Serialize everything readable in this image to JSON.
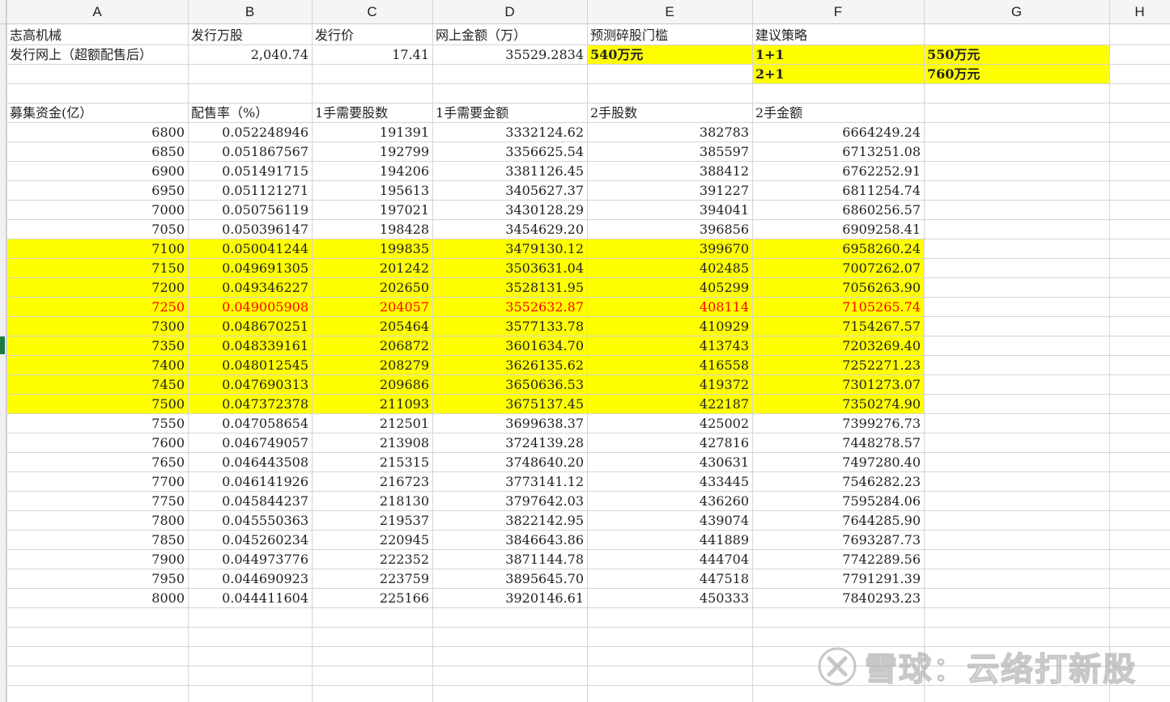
{
  "columns": [
    "A",
    "B",
    "C",
    "D",
    "E",
    "F",
    "G",
    "H"
  ],
  "row2": {
    "name": "志高机械",
    "issue_shares_label": "发行万股",
    "price_label": "发行价",
    "online_amount_label": "网上金额（万）",
    "threshold_label": "预测碎股门槛",
    "strategy_label": "建议策略"
  },
  "row3": {
    "label": "发行网上（超额配售后）",
    "issue_shares": "2,040.74",
    "price": "17.41",
    "online_amount": "35529.2834",
    "threshold": "540万元",
    "strategy_1": "1+1",
    "strategy_1_amount": "550万元"
  },
  "row4": {
    "strategy_2": "2+1",
    "strategy_2_amount": "760万元"
  },
  "table_headers": [
    "募集资金(亿）",
    "配售率（%）",
    "1手需要股数",
    "1手需要金额",
    "2手股数",
    "2手金额"
  ],
  "rows": [
    [
      "6800",
      "0.052248946",
      "191391",
      "3332124.62",
      "382783",
      "6664249.24"
    ],
    [
      "6850",
      "0.051867567",
      "192799",
      "3356625.54",
      "385597",
      "6713251.08"
    ],
    [
      "6900",
      "0.051491715",
      "194206",
      "3381126.45",
      "388412",
      "6762252.91"
    ],
    [
      "6950",
      "0.051121271",
      "195613",
      "3405627.37",
      "391227",
      "6811254.74"
    ],
    [
      "7000",
      "0.050756119",
      "197021",
      "3430128.29",
      "394041",
      "6860256.57"
    ],
    [
      "7050",
      "0.050396147",
      "198428",
      "3454629.20",
      "396856",
      "6909258.41"
    ],
    [
      "7100",
      "0.050041244",
      "199835",
      "3479130.12",
      "399670",
      "6958260.24"
    ],
    [
      "7150",
      "0.049691305",
      "201242",
      "3503631.04",
      "402485",
      "7007262.07"
    ],
    [
      "7200",
      "0.049346227",
      "202650",
      "3528131.95",
      "405299",
      "7056263.90"
    ],
    [
      "7250",
      "0.049005908",
      "204057",
      "3552632.87",
      "408114",
      "7105265.74"
    ],
    [
      "7300",
      "0.048670251",
      "205464",
      "3577133.78",
      "410929",
      "7154267.57"
    ],
    [
      "7350",
      "0.048339161",
      "206872",
      "3601634.70",
      "413743",
      "7203269.40"
    ],
    [
      "7400",
      "0.048012545",
      "208279",
      "3626135.62",
      "416558",
      "7252271.23"
    ],
    [
      "7450",
      "0.047690313",
      "209686",
      "3650636.53",
      "419372",
      "7301273.07"
    ],
    [
      "7500",
      "0.047372378",
      "211093",
      "3675137.45",
      "422187",
      "7350274.90"
    ],
    [
      "7550",
      "0.047058654",
      "212501",
      "3699638.37",
      "425002",
      "7399276.73"
    ],
    [
      "7600",
      "0.046749057",
      "213908",
      "3724139.28",
      "427816",
      "7448278.57"
    ],
    [
      "7650",
      "0.046443508",
      "215315",
      "3748640.20",
      "430631",
      "7497280.40"
    ],
    [
      "7700",
      "0.046141926",
      "216723",
      "3773141.12",
      "433445",
      "7546282.23"
    ],
    [
      "7750",
      "0.045844237",
      "218130",
      "3797642.03",
      "436260",
      "7595284.06"
    ],
    [
      "7800",
      "0.045550363",
      "219537",
      "3822142.95",
      "439074",
      "7644285.90"
    ],
    [
      "7850",
      "0.045260234",
      "220945",
      "3846643.86",
      "441889",
      "7693287.73"
    ],
    [
      "7900",
      "0.044973776",
      "222352",
      "3871144.78",
      "444704",
      "7742289.56"
    ],
    [
      "7950",
      "0.044690923",
      "223759",
      "3895645.70",
      "447518",
      "7791291.39"
    ],
    [
      "8000",
      "0.044411604",
      "225166",
      "3920146.61",
      "450333",
      "7840293.23"
    ]
  ],
  "highlight_color": "#ffff00",
  "highlight_row_start": 6,
  "highlight_row_end": 14,
  "red_row_index": 9,
  "red_color": "#ff0000",
  "watermark": {
    "text": "雪球：云络打新股",
    "icon": "snowball-logo-icon"
  }
}
